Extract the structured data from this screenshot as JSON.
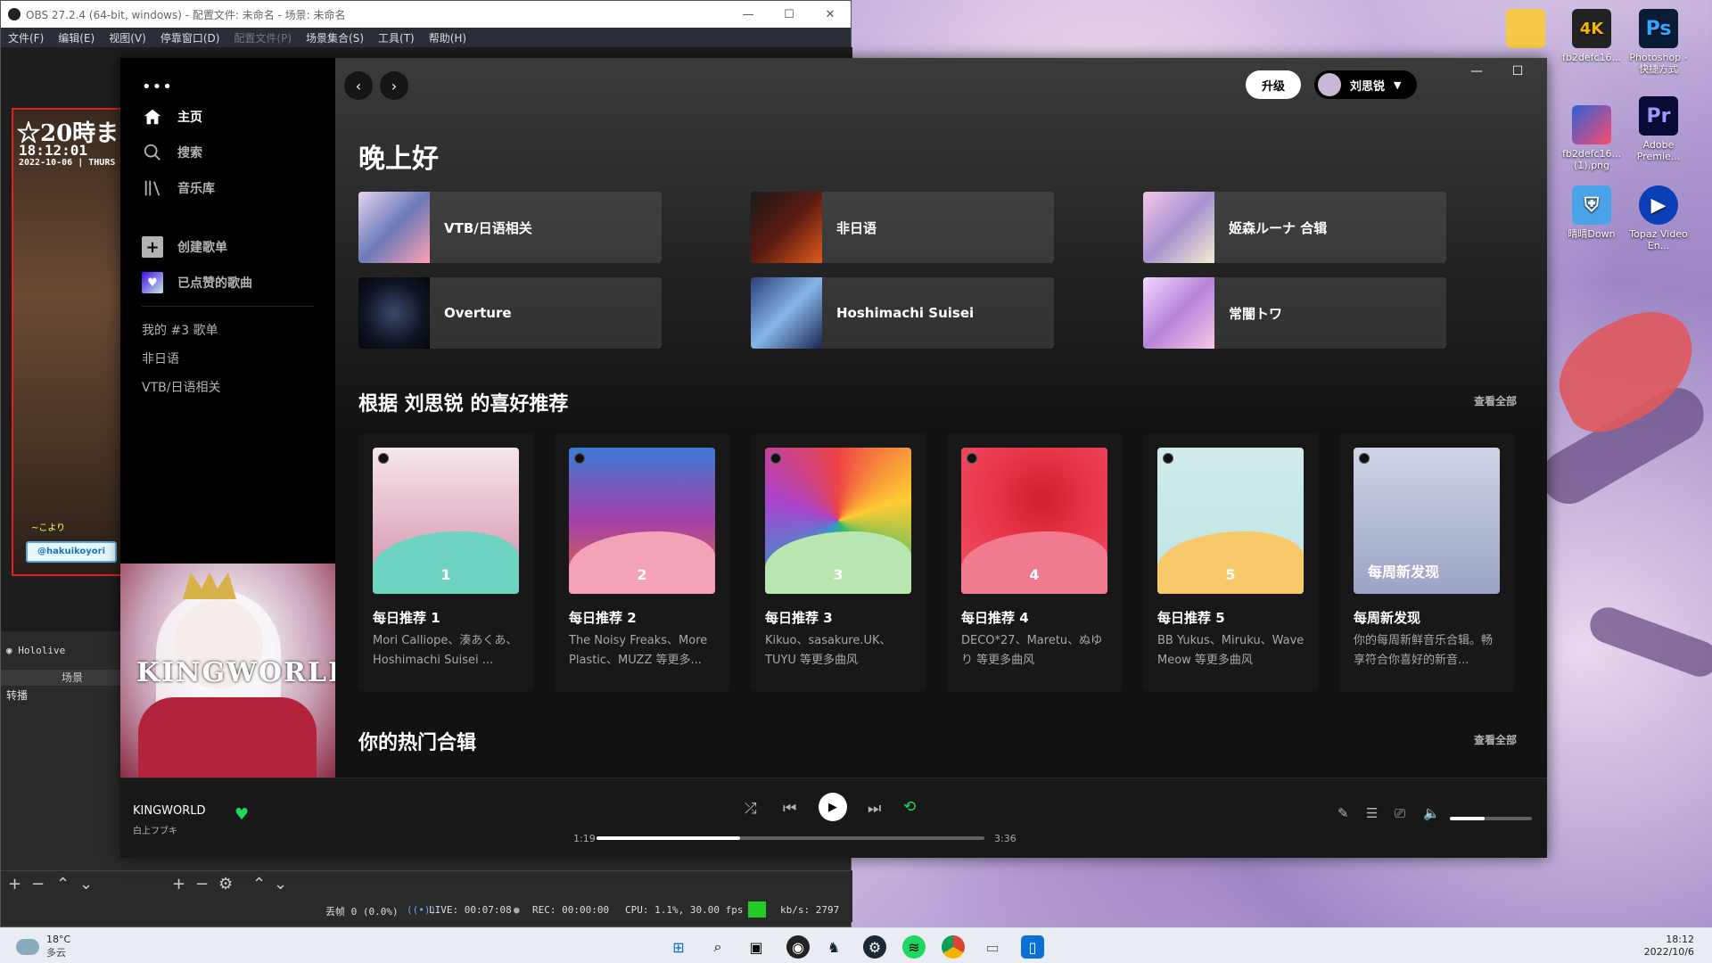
{
  "obs": {
    "title": "OBS 27.2.4 (64-bit, windows) - 配置文件: 未命名 - 场景: 未命名",
    "menu": [
      "文件(F)",
      "编辑(E)",
      "视图(V)",
      "停靠窗口(D)",
      "配置文件(P)",
      "场景集合(S)",
      "工具(T)",
      "帮助(H)"
    ],
    "preview_title": "☆20時ま",
    "preview_time": "18:12:01",
    "preview_date": "2022-10-06 | THURS",
    "preview_sig": "~こより",
    "preview_twitter": "@hakuikoyori",
    "source_label": "Hololive",
    "scenes_header": "场景",
    "scene_item": "转播",
    "status": {
      "dropped": "丢帧 0 (0.0%)",
      "live": "LIVE: 00:07:08",
      "rec": "REC: 00:00:00",
      "cpu": "CPU: 1.1%, 30.00 fps",
      "kbs": "kb/s: 2797"
    }
  },
  "desktop_icons": [
    {
      "label": "",
      "name": "folder-icon"
    },
    {
      "label": "fb2defc16...",
      "badge": "4K"
    },
    {
      "label": "Photoshop - 快捷方式",
      "badge": "Ps"
    },
    {
      "label": "fb2defc16... (1).png",
      "badge": ""
    },
    {
      "label": "Adobe Premie...",
      "badge": "Pr"
    },
    {
      "label": "晴晴Down",
      "badge": ""
    },
    {
      "label": "Topaz Video En...",
      "badge": "▶"
    }
  ],
  "spotify": {
    "nav": {
      "home": "主页",
      "search": "搜索",
      "library": "音乐库",
      "create": "创建歌单",
      "liked": "已点赞的歌曲"
    },
    "playlists": [
      "我的 #3 歌单",
      "非日语",
      "VTB/日语相关"
    ],
    "upgrade": "升级",
    "user": "刘思锐",
    "greeting": "晚上好",
    "quick_tiles": [
      {
        "name": "VTB/日语相关"
      },
      {
        "name": "非日语"
      },
      {
        "name": "姬森ルーナ 合辑"
      },
      {
        "name": "Overture"
      },
      {
        "name": "Hoshimachi Suisei"
      },
      {
        "name": "常闇トワ"
      }
    ],
    "section1_title": "根据 刘思锐 的喜好推荐",
    "section2_title": "你的热门合辑",
    "see_all": "查看全部",
    "cards": [
      {
        "num": "1",
        "title": "每日推荐 1",
        "desc": "Mori Calliope、湊あくあ、Hoshimachi Suisei ...",
        "color": "#8fd7c7",
        "wave": "#6fd3c1"
      },
      {
        "num": "2",
        "title": "每日推荐 2",
        "desc": "The Noisy Freaks、More Plastic、MUZZ 等更多...",
        "color": "#c15fa3",
        "wave": "#f4a2b7"
      },
      {
        "num": "3",
        "title": "每日推荐 3",
        "desc": "Kikuo、sasakure.UK、TUYU 等更多曲风",
        "color": "#d7e9bd",
        "wave": "#b9e6b0"
      },
      {
        "num": "4",
        "title": "每日推荐 4",
        "desc": "DECO*27、Maretu、ぬゆり 等更多曲风",
        "color": "#e8354a",
        "wave": "#f07a90"
      },
      {
        "num": "5",
        "title": "每日推荐 5",
        "desc": "BB Yukus、Miruku、Wave Meow 等更多曲风",
        "color": "#bfe5e4",
        "wave": "#f7c96b"
      },
      {
        "num": "每周新发现",
        "title": "每周新发现",
        "desc": "你的每周新鲜音乐合辑。畅享符合你喜好的新音...",
        "color": "#b8bfd6",
        "wave": "#c9d1e3"
      }
    ],
    "now_playing": {
      "title": "KINGWORLD",
      "artist": "白上フブキ",
      "elapsed": "1:19",
      "total": "3:36",
      "progress": 0.37,
      "volume": 0.42
    },
    "cover_text": "KINGWORLD"
  },
  "taskbar": {
    "temp": "18°C",
    "weather": "多云",
    "time": "18:12",
    "date": "2022/10/6"
  }
}
